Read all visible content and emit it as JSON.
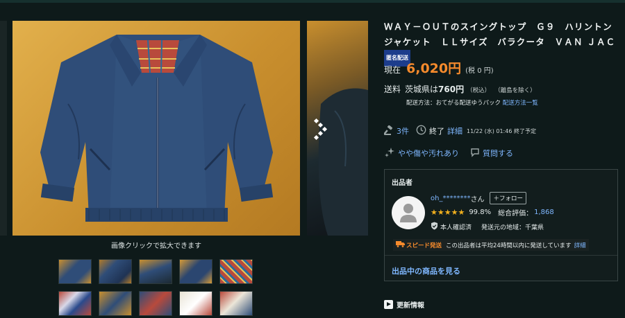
{
  "gallery": {
    "caption": "画像クリックで拡大できます"
  },
  "item": {
    "title": "ＷＡＹ－ＯＵＴのスイングトップ　Ｇ９　ハリントンジャケット　ＬＬサイズ　バラクータ　ＶＡＮ ＪＡＣ",
    "anonymous_badge": "匿名配送"
  },
  "price": {
    "label": "現在",
    "value": "6,020円",
    "tax": "(税 0 円)"
  },
  "shipping": {
    "label": "送料",
    "destination": "茨城県は",
    "fee": "760円",
    "tax": "（税込）",
    "note": "（離島を除く）",
    "method_label": "配送方法：おてがる配送ゆうパック",
    "method_link": "配送方法一覧"
  },
  "auction": {
    "bids": "3件",
    "status": "終了",
    "details_link": "詳細",
    "end_time": "11/22 (水) 01:46 終了予定"
  },
  "condition": {
    "label": "やや傷や汚れあり",
    "question_link": "質問する"
  },
  "seller": {
    "heading": "出品者",
    "name": "oh_********",
    "honorific": "さん",
    "follow_label": "＋フォロー",
    "stars": "★★★★★",
    "positive_rate": "99.8%",
    "total_label": "総合評価：",
    "total_value": "1,868",
    "verified": "本人確認済",
    "region": "発送元の地域：千葉県",
    "speed_tag": "スピード発送",
    "speed_text": "この出品者は平均24時間以内に発送しています",
    "speed_link": "詳細",
    "see_items": "出品中の商品を見る"
  },
  "update": {
    "label": "更新情報"
  },
  "colors": {
    "accent_price": "#f58a2c",
    "link": "#7fb7ff",
    "star": "#f2b01e",
    "badge_bg": "#1d3d8c",
    "background": "#0e1a1a"
  }
}
